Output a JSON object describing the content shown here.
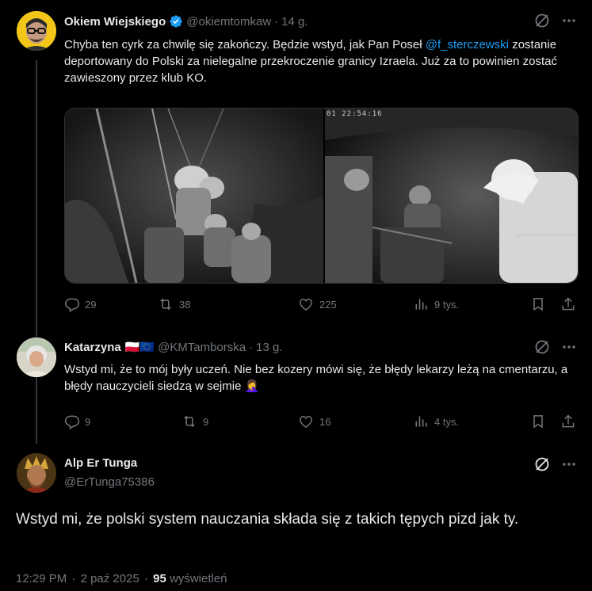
{
  "tweet1": {
    "name": "Okiem Wiejskiego",
    "handle": "@okiemtomkaw",
    "sep": "·",
    "time": "14 g.",
    "text_before": "Chyba ten cyrk za chwilę się zakończy. Będzie wstyd, jak Pan Poseł",
    "mention": "@f_sterczewski",
    "text_after": "zostanie deportowany do Polski za nielegalne przekroczenie granicy Izraela. Już za to powinien zostać zawieszony przez klub KO.",
    "video_timestamp": "01 22:54:16",
    "stats": {
      "replies": "29",
      "reposts": "38",
      "likes": "225",
      "views": "9 tys."
    }
  },
  "tweet2": {
    "name": "Katarzyna",
    "flags": "🇵🇱🇪🇺",
    "handle": "@KMTamborska",
    "sep": "·",
    "time": "13 g.",
    "text": "Wstyd mi, że to mój były uczeń. Nie bez kozery mówi się, że błędy lekarzy leżą na cmentarzu, a błędy nauczycieli siedzą w sejmie 🤦‍♀️",
    "stats": {
      "replies": "9",
      "reposts": "9",
      "likes": "16",
      "views": "4 tys."
    }
  },
  "tweet3": {
    "name": "Alp Er Tunga",
    "handle": "@ErTunga75386",
    "text": "Wstyd mi, że polski system nauczania składa się z takich tępych pizd jak ty.",
    "time": "12:29 PM",
    "sep": "·",
    "date": "2 paź 2025",
    "views_count": "95",
    "views_label": "wyświetleń"
  },
  "colors": {
    "background": "#000000",
    "text": "#e7e9ea",
    "muted": "#71767b",
    "accent": "#1d9bf0",
    "verified": "#1d9bf0",
    "divider": "#333639"
  },
  "icons": [
    "verified-badge-icon",
    "grok-icon",
    "more-icon",
    "reply-icon",
    "repost-icon",
    "like-icon",
    "views-icon",
    "bookmark-icon",
    "share-icon"
  ]
}
